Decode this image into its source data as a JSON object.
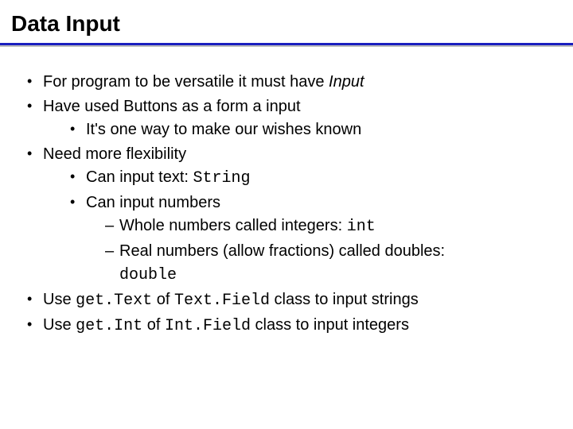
{
  "title": "Data Input",
  "bullets": {
    "b1_1a": "For program to be versatile it must have ",
    "b1_1b": "Input",
    "b1_2": "Have used Buttons as a form a input",
    "b2_2_1": "It's one way to make our wishes known",
    "b1_3": "Need more flexibility",
    "b2_3_1a": "Can input text: ",
    "b2_3_1b": "String",
    "b2_3_2": "Can input numbers",
    "b3_3_2_1a": "Whole numbers called integers: ",
    "b3_3_2_1b": "int",
    "b3_3_2_2a": "Real numbers (allow fractions) called doubles: ",
    "b3_3_2_2b": "double",
    "b1_4a": "Use ",
    "b1_4b": "get.Text",
    "b1_4c": " of ",
    "b1_4d": "Text.Field",
    "b1_4e": " class to input strings",
    "b1_5a": "Use ",
    "b1_5b": "get.Int",
    "b1_5c": " of ",
    "b1_5d": "Int.Field",
    "b1_5e": " class to input integers"
  }
}
